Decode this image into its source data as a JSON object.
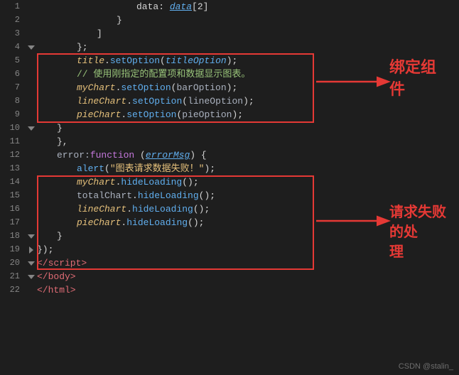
{
  "lines": [
    {
      "num": "1",
      "fold": false,
      "foldDown": false,
      "indent": 20,
      "content": "data: <span class='italic-blue underline'>data</span><span class='white'>[2]</span>"
    },
    {
      "num": "2",
      "fold": false,
      "foldDown": false,
      "indent": 16,
      "content": "<span class='white'>}</span>"
    },
    {
      "num": "3",
      "fold": false,
      "foldDown": false,
      "indent": 12,
      "content": "<span class='white'>]</span>"
    },
    {
      "num": "4",
      "fold": true,
      "foldDown": true,
      "indent": 8,
      "content": "<span class='white'>};</span>"
    },
    {
      "num": "5",
      "fold": false,
      "foldDown": false,
      "indent": 8,
      "content": "<span class='italic-yellow'>title</span><span class='white'>.</span><span class='fn'>setOption</span><span class='white'>(</span><span class='italic-blue'>titleOption</span><span class='white'>);</span>"
    },
    {
      "num": "6",
      "fold": false,
      "foldDown": false,
      "indent": 8,
      "content": "<span class='comment'>// 使用刚指定的配置项和数据显示图表。</span>"
    },
    {
      "num": "7",
      "fold": false,
      "foldDown": false,
      "indent": 8,
      "content": "<span class='italic-yellow'>myChart</span><span class='white'>.</span><span class='fn'>setOption</span><span class='white'>(</span><span class='plain'>barOption</span><span class='white'>);</span>"
    },
    {
      "num": "8",
      "fold": false,
      "foldDown": false,
      "indent": 8,
      "content": "<span class='italic-yellow'>lineChart</span><span class='white'>.</span><span class='fn'>setOption</span><span class='white'>(</span><span class='plain'>lineOption</span><span class='white'>);</span>"
    },
    {
      "num": "9",
      "fold": false,
      "foldDown": false,
      "indent": 8,
      "content": "<span class='italic-yellow'>pieChart</span><span class='white'>.</span><span class='fn'>setOption</span><span class='white'>(</span><span class='plain'>pieOption</span><span class='white'>);</span>"
    },
    {
      "num": "10",
      "fold": true,
      "foldDown": true,
      "indent": 4,
      "content": "<span class='white'>}</span>"
    },
    {
      "num": "11",
      "fold": false,
      "foldDown": false,
      "indent": 4,
      "content": "<span class='white'>},</span>"
    },
    {
      "num": "12",
      "fold": false,
      "foldDown": false,
      "indent": 4,
      "content": "<span class='plain'>error:</span><span class='kw'>function</span><span class='white'> (</span><span class='italic-blue underline'>errorMsg</span><span class='white'>) {</span>"
    },
    {
      "num": "13",
      "fold": false,
      "foldDown": false,
      "indent": 8,
      "content": "<span class='fn'>alert</span><span class='white'>(</span><span class='str'>\"图表请求数据失败！\"</span><span class='white'>);</span>"
    },
    {
      "num": "14",
      "fold": false,
      "foldDown": false,
      "indent": 8,
      "content": "<span class='italic-yellow'>myChart</span><span class='white'>.</span><span class='fn'>hideLoading</span><span class='white'>();</span>"
    },
    {
      "num": "15",
      "fold": false,
      "foldDown": false,
      "indent": 8,
      "content": "<span class='plain'>totalChart</span><span class='white'>.</span><span class='fn'>hideLoading</span><span class='white'>();</span>"
    },
    {
      "num": "16",
      "fold": false,
      "foldDown": false,
      "indent": 8,
      "content": "<span class='italic-yellow'>lineChart</span><span class='white'>.</span><span class='fn'>hideLoading</span><span class='white'>();</span>"
    },
    {
      "num": "17",
      "fold": false,
      "foldDown": false,
      "indent": 8,
      "content": "<span class='italic-yellow'>pieChart</span><span class='white'>.</span><span class='fn'>hideLoading</span><span class='white'>();</span>"
    },
    {
      "num": "18",
      "fold": true,
      "foldDown": true,
      "indent": 4,
      "content": "<span class='white'>}</span>"
    },
    {
      "num": "19",
      "fold": true,
      "foldDown": false,
      "indent": 0,
      "content": "<span class='white'>});</span>"
    },
    {
      "num": "20",
      "fold": true,
      "foldDown": true,
      "indent": 0,
      "content": "<span class='red'>&lt;/script&gt;</span>"
    },
    {
      "num": "21",
      "fold": true,
      "foldDown": true,
      "indent": 0,
      "content": "<span class='red'>&lt;/body&gt;</span>"
    },
    {
      "num": "22",
      "fold": false,
      "foldDown": false,
      "indent": 0,
      "content": "<span class='red'>&lt;/html&gt;</span>"
    }
  ],
  "box1": {
    "label": "绑定组\n件",
    "arrowText": "→"
  },
  "box2": {
    "label": "请求失败的处\n理",
    "arrowText": "→"
  },
  "watermark": "CSDN @stalin_"
}
